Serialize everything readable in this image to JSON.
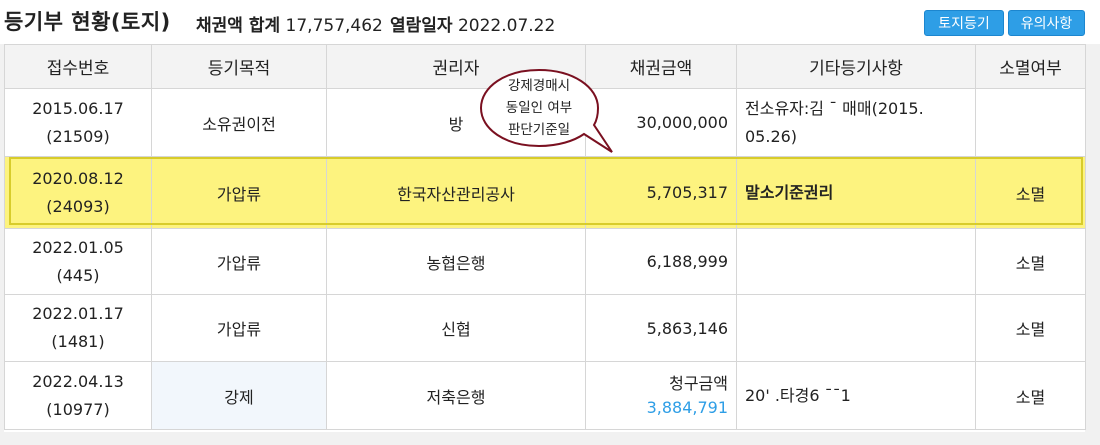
{
  "header": {
    "title": "등기부 현황(토지)",
    "claim_total_label": "채권액 합계",
    "claim_total_value": "17,757,462",
    "view_date_label": "열람일자",
    "view_date_value": "2022.07.22",
    "buttons": {
      "land_registry": "토지등기",
      "notes": "유의사항"
    }
  },
  "columns": [
    "접수번호",
    "등기목적",
    "권리자",
    "채권금액",
    "기타등기사항",
    "소멸여부"
  ],
  "rows": [
    {
      "date": "2015.06.17",
      "receipt_no": "(21509)",
      "purpose": "소유권이전",
      "holder": "방",
      "amount": "30,000,000",
      "note_line1": "전소유자:김 ¯ 매매(2015.",
      "note_line2": "05.26)",
      "status": ""
    },
    {
      "date": "2020.08.12",
      "receipt_no": "(24093)",
      "purpose": "가압류",
      "holder": "한국자산관리공사",
      "amount": "5,705,317",
      "note": "말소기준권리",
      "status": "소멸"
    },
    {
      "date": "2022.01.05",
      "receipt_no": "(445)",
      "purpose": "가압류",
      "holder": "농협은행",
      "amount": "6,188,999",
      "note": "",
      "status": "소멸"
    },
    {
      "date": "2022.01.17",
      "receipt_no": "(1481)",
      "purpose": "가압류",
      "holder": "신협",
      "amount": "5,863,146",
      "note": "",
      "status": "소멸"
    },
    {
      "date": "2022.04.13",
      "receipt_no": "(10977)",
      "purpose": "강제",
      "holder": "저축은행",
      "amount_label": "청구금액",
      "amount": "3,884,791",
      "note": "20' .타경6 ¯¯1",
      "status": "소멸"
    }
  ],
  "annotation": {
    "line1": "강제경매시",
    "line2": "동일인 여부",
    "line3": "판단기준일"
  },
  "colors": {
    "button": "#2e9ee6",
    "highlight": "#fdf37f",
    "claim_amount": "#2e9ee6",
    "bubble_border": "#7a1020"
  }
}
